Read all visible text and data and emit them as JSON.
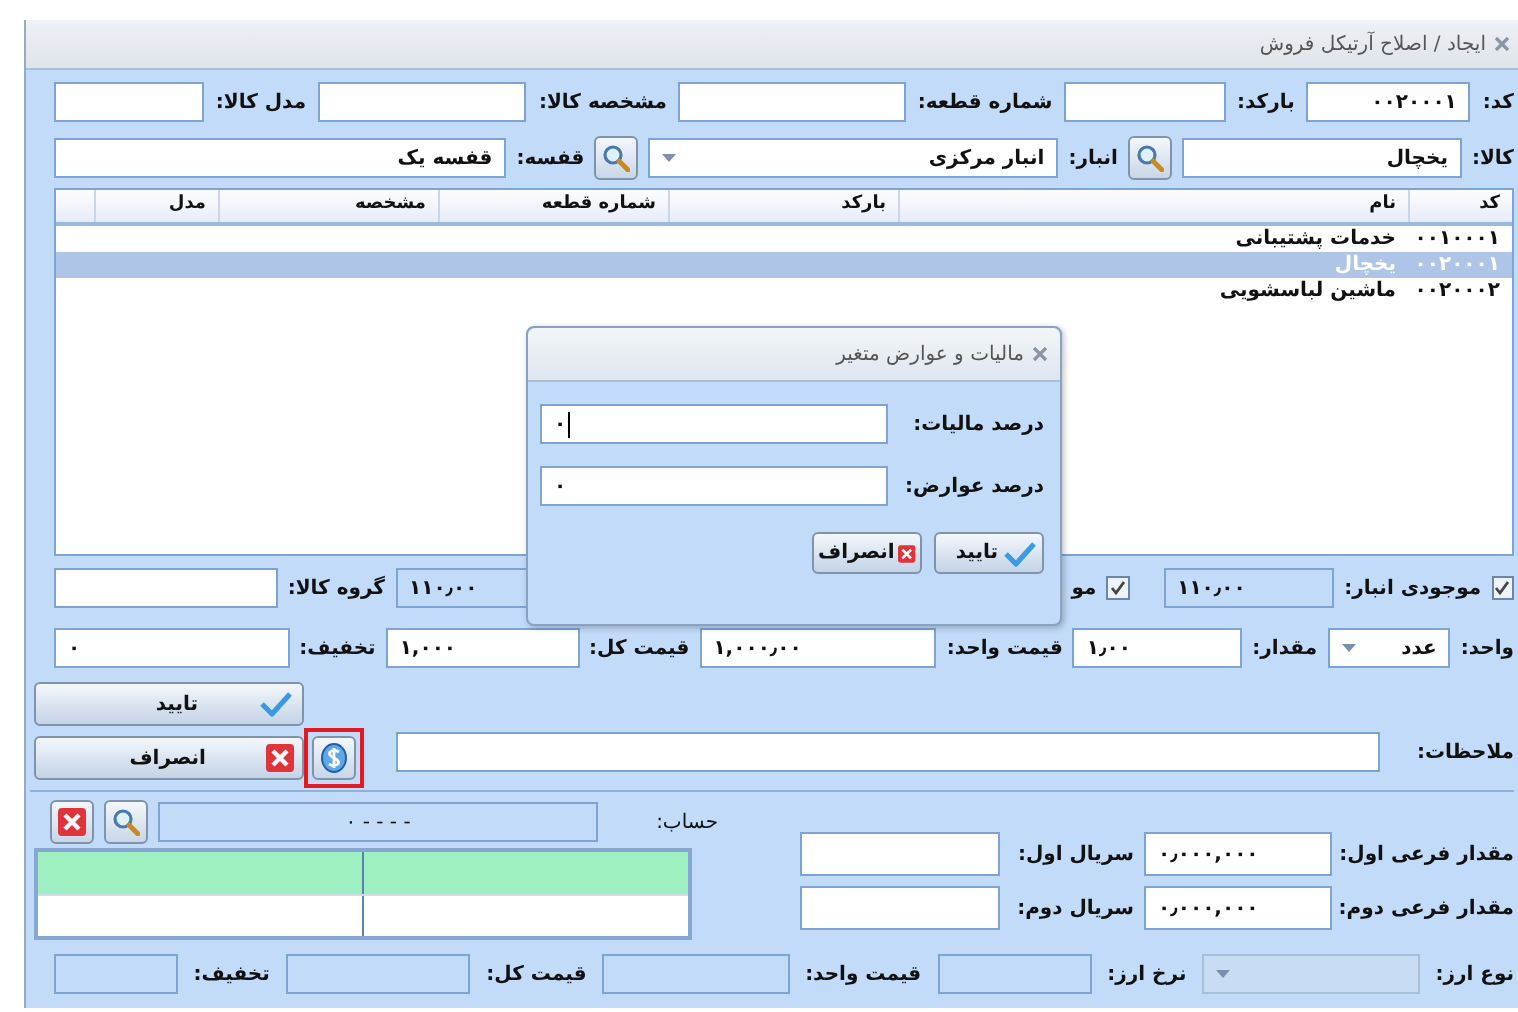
{
  "window": {
    "title": "ایجاد / اصلاح آرتیکل فروش"
  },
  "header": {
    "code": {
      "label": "کد:",
      "value": "۰۰۲۰۰۰۱"
    },
    "barcode": {
      "label": "بارکد:"
    },
    "part_number": {
      "label": "شماره قطعه:"
    },
    "item_spec": {
      "label": "مشخصه کالا:"
    },
    "item_model": {
      "label": "مدل کالا:"
    },
    "item": {
      "label": "کالا:",
      "value": "یخچال"
    },
    "warehouse": {
      "label": "انبار:",
      "value": "انبار مرکزی"
    },
    "shelf": {
      "label": "قفسه:",
      "value": "قفسه یک"
    }
  },
  "table": {
    "columns": [
      "کد",
      "نام",
      "بارکد",
      "شماره قطعه",
      "مشخصه",
      "مدل"
    ],
    "rows": [
      {
        "cells": [
          "۰۰۱۰۰۰۱",
          "خدمات پشتیبانی"
        ],
        "selected": false
      },
      {
        "cells": [
          "۰۰۲۰۰۰۱",
          "یخچال"
        ],
        "selected": true
      },
      {
        "cells": [
          "۰۰۲۰۰۰۲",
          "ماشین لباسشویی"
        ],
        "selected": false
      }
    ]
  },
  "stock": {
    "label": "موجودی انبار:",
    "checked": true,
    "value": "۱۱۰٫۰۰"
  },
  "stock_2": {
    "label": "مو",
    "checked": true,
    "value": "۱۱۰٫۰۰"
  },
  "item_group": {
    "label": "گروه کالا:"
  },
  "unit": {
    "label": "واحد:",
    "value": "عدد"
  },
  "quantity": {
    "label": "مقدار:",
    "value": "۱٫۰۰"
  },
  "unit_price": {
    "label": "قیمت واحد:",
    "value": "۱,۰۰۰٫۰۰"
  },
  "total_price": {
    "label": "قیمت کل:",
    "value": "۱,۰۰۰"
  },
  "discount": {
    "label": "تخفیف:",
    "value": "۰"
  },
  "actions": {
    "confirm": "تایید",
    "cancel": "انصراف",
    "tax_button_highlighted": true
  },
  "notes": {
    "label": "ملاحظات:"
  },
  "account": {
    "label": "حساب:",
    "value": "۰ - - - -"
  },
  "sub_quantity_1": {
    "label": "مقدار فرعی اول:",
    "value": "۰٫۰۰۰,۰۰۰"
  },
  "serial_1": {
    "label": "سریال اول:"
  },
  "sub_quantity_2": {
    "label": "مقدار فرعی دوم:",
    "value": "۰٫۰۰۰,۰۰۰"
  },
  "serial_2": {
    "label": "سریال دوم:"
  },
  "currency": {
    "type_label": "نوع ارز:",
    "rate_label": "نرخ ارز:",
    "unit_price_label": "قیمت واحد:",
    "total_label": "قیمت کل:",
    "discount_label": "تخفیف:"
  },
  "dialog": {
    "title": "مالیات و عوارض متغیر",
    "tax": {
      "label": "درصد مالیات:",
      "value": "۰",
      "focused": true
    },
    "duties": {
      "label": "درصد عوارض:",
      "value": "۰"
    },
    "confirm": "تایید",
    "cancel": "انصراف"
  }
}
